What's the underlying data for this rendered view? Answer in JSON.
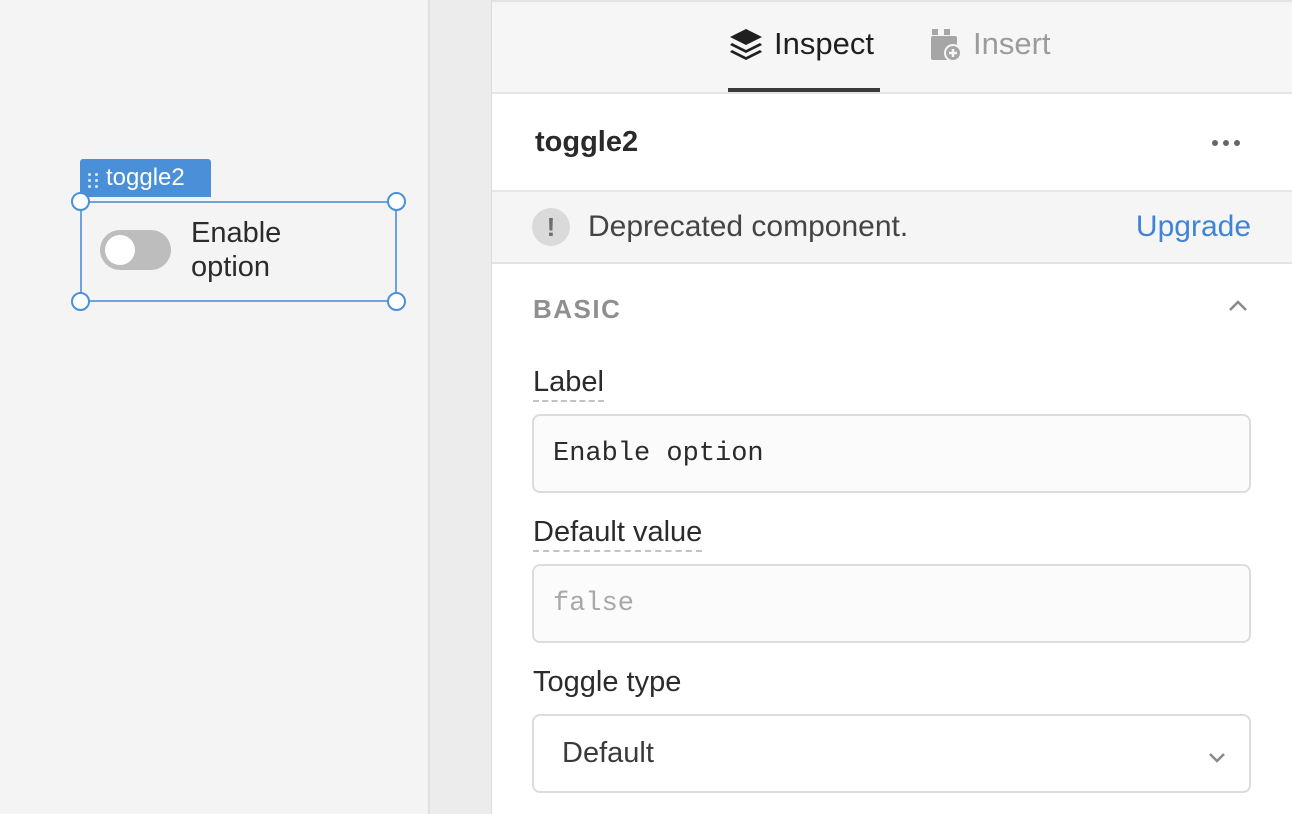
{
  "canvas": {
    "component_tag": "toggle2",
    "toggle": {
      "label": "Enable option",
      "checked": false
    }
  },
  "tabs": [
    {
      "label": "Inspect",
      "icon": "layers-icon",
      "active": true
    },
    {
      "label": "Insert",
      "icon": "insert-component-icon",
      "active": false
    }
  ],
  "component": {
    "name": "toggle2",
    "menu_icon": "more-horizontal-icon"
  },
  "deprecation": {
    "message": "Deprecated component.",
    "action": "Upgrade",
    "icon": "exclamation-icon"
  },
  "section": {
    "title": "BASIC",
    "collapse_icon": "chevron-up-icon"
  },
  "fields": {
    "label": {
      "label": "Label",
      "value": "Enable option"
    },
    "default_value": {
      "label": "Default value",
      "placeholder": "false"
    },
    "toggle_type": {
      "label": "Toggle type",
      "selected": "Default",
      "icon": "chevron-down-icon"
    }
  },
  "colors": {
    "accent": "#4a90d9",
    "link": "#3f84d6"
  }
}
